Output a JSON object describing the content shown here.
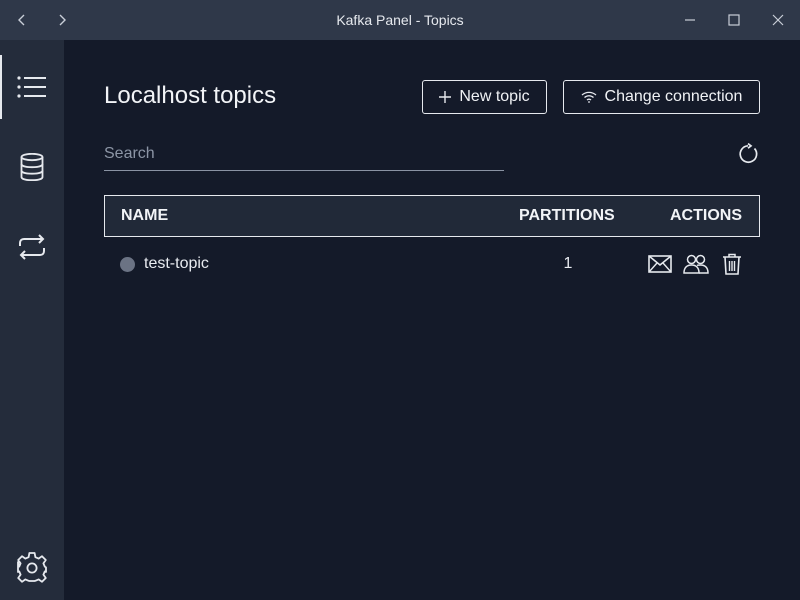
{
  "window": {
    "title": "Kafka Panel - Topics",
    "nav_back_icon": "chevron-left-icon",
    "nav_forward_icon": "chevron-right-icon",
    "minimize_icon": "minimize-icon",
    "maximize_icon": "maximize-icon",
    "close_icon": "close-icon"
  },
  "sidebar": {
    "items": [
      {
        "id": "topics",
        "icon": "list-icon",
        "active": true
      },
      {
        "id": "data",
        "icon": "database-icon",
        "active": false
      },
      {
        "id": "consumers",
        "icon": "repeat-icon",
        "active": false
      }
    ],
    "settings_icon": "gear-icon"
  },
  "header": {
    "title": "Localhost topics",
    "new_topic_label": "New topic",
    "change_connection_label": "Change connection"
  },
  "search": {
    "placeholder": "Search",
    "value": ""
  },
  "table": {
    "columns": {
      "name": "NAME",
      "partitions": "PARTITIONS",
      "actions": "ACTIONS"
    },
    "rows": [
      {
        "name": "test-topic",
        "partitions": "1",
        "status_color": "#6b7384"
      }
    ],
    "action_icons": [
      "envelope-icon",
      "users-icon",
      "trash-icon"
    ]
  },
  "colors": {
    "background": "#141a29",
    "sidebar": "#242c3b",
    "titlebar": "#2f3849",
    "text": "#e8ebf0"
  }
}
